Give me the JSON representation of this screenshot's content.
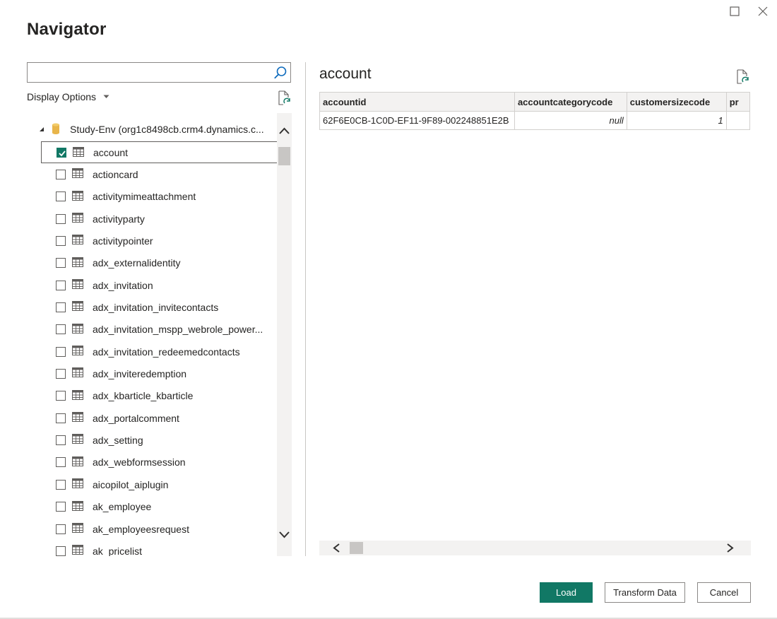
{
  "window": {
    "title": "Navigator",
    "controls": [
      "maximize",
      "close"
    ]
  },
  "left_pane": {
    "search": {
      "value": "",
      "placeholder": ""
    },
    "display_options_label": "Display Options",
    "tree": {
      "root_label": "Study-Env (org1c8498cb.crm4.dynamics.c...",
      "root_expanded": true,
      "items": [
        {
          "label": "account",
          "checked": true,
          "selected": true
        },
        {
          "label": "actioncard",
          "checked": false
        },
        {
          "label": "activitymimeattachment",
          "checked": false
        },
        {
          "label": "activityparty",
          "checked": false
        },
        {
          "label": "activitypointer",
          "checked": false
        },
        {
          "label": "adx_externalidentity",
          "checked": false
        },
        {
          "label": "adx_invitation",
          "checked": false
        },
        {
          "label": "adx_invitation_invitecontacts",
          "checked": false
        },
        {
          "label": "adx_invitation_mspp_webrole_power...",
          "checked": false
        },
        {
          "label": "adx_invitation_redeemedcontacts",
          "checked": false
        },
        {
          "label": "adx_inviteredemption",
          "checked": false
        },
        {
          "label": "adx_kbarticle_kbarticle",
          "checked": false
        },
        {
          "label": "adx_portalcomment",
          "checked": false
        },
        {
          "label": "adx_setting",
          "checked": false
        },
        {
          "label": "adx_webformsession",
          "checked": false
        },
        {
          "label": "aicopilot_aiplugin",
          "checked": false
        },
        {
          "label": "ak_employee",
          "checked": false
        },
        {
          "label": "ak_employeesrequest",
          "checked": false
        },
        {
          "label": "ak_pricelist",
          "checked": false
        }
      ]
    }
  },
  "preview": {
    "title": "account",
    "columns": [
      "accountid",
      "accountcategorycode",
      "customersizecode",
      "pr"
    ],
    "rows": [
      [
        "62F6E0CB-1C0D-EF11-9F89-002248851E2B",
        "null",
        "1",
        ""
      ]
    ]
  },
  "footer": {
    "load_label": "Load",
    "transform_label": "Transform Data",
    "cancel_label": "Cancel"
  },
  "colors": {
    "accent": "#117865",
    "scrollbar_track": "#f3f2f1",
    "scrollbar_thumb": "#c8c6c4",
    "header_bg": "#f3f2f1",
    "db_icon": "#e8b54a",
    "table_icon": "#605e5c"
  },
  "icons": {
    "search": "search-icon",
    "refresh": "refresh-icon",
    "database": "database-icon",
    "table": "table-icon",
    "maximize": "maximize-icon",
    "close": "close-icon"
  }
}
